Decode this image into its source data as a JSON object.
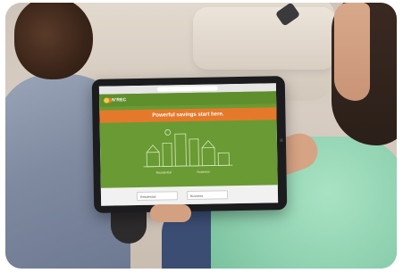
{
  "tablet_screen": {
    "brand_label": "N'REC",
    "banner_text": "Powerful savings start here.",
    "illustration_labels": [
      "Residential",
      "Business"
    ],
    "footer_buttons": [
      "Residential",
      "Business"
    ]
  },
  "colors": {
    "screen_green": "#6a9a33",
    "banner_orange": "#e5792b",
    "shirt_mint": "#8fd1b0"
  }
}
